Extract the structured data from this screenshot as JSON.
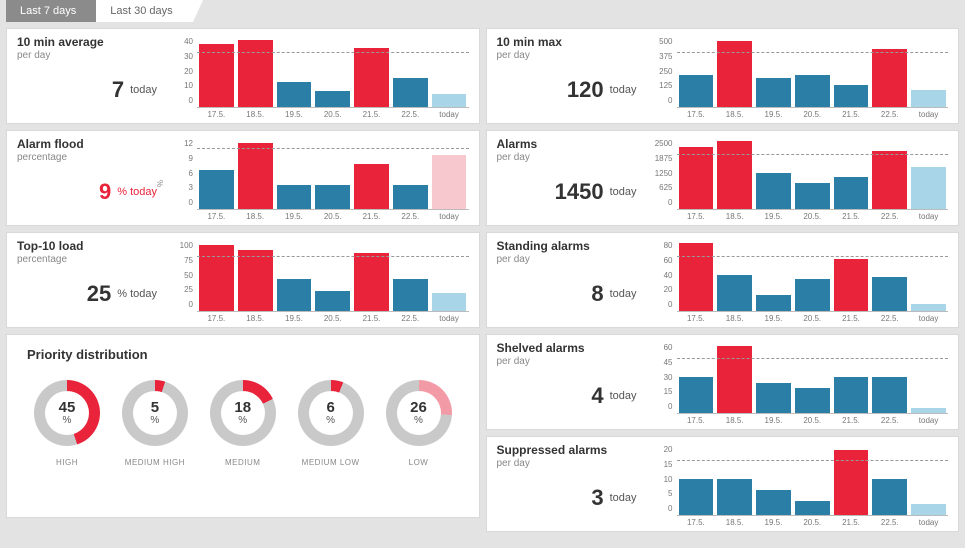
{
  "tabs": {
    "active": "Last 7 days",
    "inactive": "Last 30 days"
  },
  "categories": [
    "17.5.",
    "18.5.",
    "19.5.",
    "20.5.",
    "21.5.",
    "22.5.",
    "today"
  ],
  "today_label": "today",
  "colors": {
    "red": "#e8233a",
    "blue": "#2b7ea6",
    "lightblue": "#a8d6e8",
    "lightred": "#f7c9cf",
    "grey": "#c9c9c9"
  },
  "panels": {
    "avg10": {
      "title": "10 min average",
      "sub": "per day",
      "value": "7",
      "unit": "today",
      "alarm": false,
      "yticks": [
        "40",
        "30",
        "20",
        "10",
        "0"
      ],
      "ylabel": ""
    },
    "flood": {
      "title": "Alarm flood",
      "sub": "percentage",
      "value": "9",
      "unit": "% today",
      "alarm": true,
      "yticks": [
        "12",
        "9",
        "6",
        "3",
        "0"
      ],
      "ylabel": "%"
    },
    "top10": {
      "title": "Top-10 load",
      "sub": "percentage",
      "value": "25",
      "unit": "% today",
      "alarm": false,
      "yticks": [
        "100",
        "75",
        "50",
        "25",
        "0"
      ],
      "ylabel": ""
    },
    "max10": {
      "title": "10 min max",
      "sub": "per day",
      "value": "120",
      "unit": "today",
      "alarm": false,
      "yticks": [
        "500",
        "375",
        "250",
        "125",
        "0"
      ],
      "ylabel": ""
    },
    "alarms": {
      "title": "Alarms",
      "sub": "per day",
      "value": "1450",
      "unit": "today",
      "alarm": false,
      "yticks": [
        "2500",
        "1875",
        "1250",
        "625",
        "0"
      ],
      "ylabel": ""
    },
    "standing": {
      "title": "Standing alarms",
      "sub": "per day",
      "value": "8",
      "unit": "today",
      "alarm": false,
      "yticks": [
        "80",
        "60",
        "40",
        "20",
        "0"
      ],
      "ylabel": ""
    },
    "shelved": {
      "title": "Shelved alarms",
      "sub": "per day",
      "value": "4",
      "unit": "today",
      "alarm": false,
      "yticks": [
        "60",
        "45",
        "30",
        "15",
        "0"
      ],
      "ylabel": ""
    },
    "supp": {
      "title": "Suppressed alarms",
      "sub": "per day",
      "value": "3",
      "unit": "today",
      "alarm": false,
      "yticks": [
        "20",
        "15",
        "10",
        "5",
        "0"
      ],
      "ylabel": ""
    }
  },
  "chart_data": [
    {
      "id": "avg10",
      "type": "bar",
      "title": "10 min average per day",
      "ylim": [
        0,
        40
      ],
      "grid": 30,
      "categories": [
        "17.5.",
        "18.5.",
        "19.5.",
        "20.5.",
        "21.5.",
        "22.5.",
        "today"
      ],
      "values": [
        35,
        37,
        14,
        9,
        33,
        16,
        7
      ],
      "colors": [
        "red",
        "red",
        "blue",
        "blue",
        "red",
        "blue",
        "lightblue"
      ]
    },
    {
      "id": "flood",
      "type": "bar",
      "title": "Alarm flood percentage",
      "ylim": [
        0,
        12
      ],
      "grid": 10,
      "ylabel": "%",
      "categories": [
        "17.5.",
        "18.5.",
        "19.5.",
        "20.5.",
        "21.5.",
        "22.5.",
        "today"
      ],
      "values": [
        6.5,
        11,
        4,
        4,
        7.5,
        4,
        9
      ],
      "colors": [
        "blue",
        "red",
        "blue",
        "blue",
        "red",
        "blue",
        "lightred"
      ]
    },
    {
      "id": "top10",
      "type": "bar",
      "title": "Top-10 load percentage",
      "ylim": [
        0,
        100
      ],
      "grid": 75,
      "categories": [
        "17.5.",
        "18.5.",
        "19.5.",
        "20.5.",
        "21.5.",
        "22.5.",
        "today"
      ],
      "values": [
        92,
        85,
        45,
        28,
        80,
        44,
        25
      ],
      "colors": [
        "red",
        "red",
        "blue",
        "blue",
        "red",
        "blue",
        "lightblue"
      ]
    },
    {
      "id": "max10",
      "type": "bar",
      "title": "10 min max per day",
      "ylim": [
        0,
        500
      ],
      "grid": 375,
      "categories": [
        "17.5.",
        "18.5.",
        "19.5.",
        "20.5.",
        "21.5.",
        "22.5.",
        "today"
      ],
      "values": [
        220,
        460,
        200,
        225,
        150,
        400,
        120
      ],
      "colors": [
        "blue",
        "red",
        "blue",
        "blue",
        "blue",
        "red",
        "lightblue"
      ]
    },
    {
      "id": "alarms",
      "type": "bar",
      "title": "Alarms per day",
      "ylim": [
        0,
        2500
      ],
      "grid": 1875,
      "categories": [
        "17.5.",
        "18.5.",
        "19.5.",
        "20.5.",
        "21.5.",
        "22.5.",
        "today"
      ],
      "values": [
        2150,
        2350,
        1250,
        900,
        1100,
        2000,
        1450
      ],
      "colors": [
        "red",
        "red",
        "blue",
        "blue",
        "blue",
        "red",
        "lightblue"
      ]
    },
    {
      "id": "standing",
      "type": "bar",
      "title": "Standing alarms per day",
      "ylim": [
        0,
        80
      ],
      "grid": 60,
      "categories": [
        "17.5.",
        "18.5.",
        "19.5.",
        "20.5.",
        "21.5.",
        "22.5.",
        "today"
      ],
      "values": [
        76,
        40,
        18,
        36,
        58,
        38,
        8
      ],
      "colors": [
        "red",
        "blue",
        "blue",
        "blue",
        "red",
        "blue",
        "lightblue"
      ]
    },
    {
      "id": "shelved",
      "type": "bar",
      "title": "Shelved alarms per day",
      "ylim": [
        0,
        60
      ],
      "grid": 45,
      "categories": [
        "17.5.",
        "18.5.",
        "19.5.",
        "20.5.",
        "21.5.",
        "22.5.",
        "today"
      ],
      "values": [
        30,
        56,
        25,
        21,
        30,
        30,
        4
      ],
      "colors": [
        "blue",
        "red",
        "blue",
        "blue",
        "blue",
        "blue",
        "lightblue"
      ]
    },
    {
      "id": "supp",
      "type": "bar",
      "title": "Suppressed alarms per day",
      "ylim": [
        0,
        20
      ],
      "grid": 15,
      "categories": [
        "17.5.",
        "18.5.",
        "19.5.",
        "20.5.",
        "21.5.",
        "22.5.",
        "today"
      ],
      "values": [
        10,
        10,
        7,
        4,
        18,
        10,
        3
      ],
      "colors": [
        "blue",
        "blue",
        "blue",
        "blue",
        "red",
        "blue",
        "lightblue"
      ]
    }
  ],
  "priority": {
    "title": "Priority distribution",
    "items": [
      {
        "label": "HIGH",
        "value": 45,
        "fill": "#e8233a",
        "track": "#c9c9c9"
      },
      {
        "label": "MEDIUM HIGH",
        "value": 5,
        "fill": "#e8233a",
        "track": "#c9c9c9"
      },
      {
        "label": "MEDIUM",
        "value": 18,
        "fill": "#e8233a",
        "track": "#c9c9c9"
      },
      {
        "label": "MEDIUM LOW",
        "value": 6,
        "fill": "#e8233a",
        "track": "#c9c9c9"
      },
      {
        "label": "LOW",
        "value": 26,
        "fill": "#f29aa6",
        "track": "#c9c9c9"
      }
    ]
  }
}
